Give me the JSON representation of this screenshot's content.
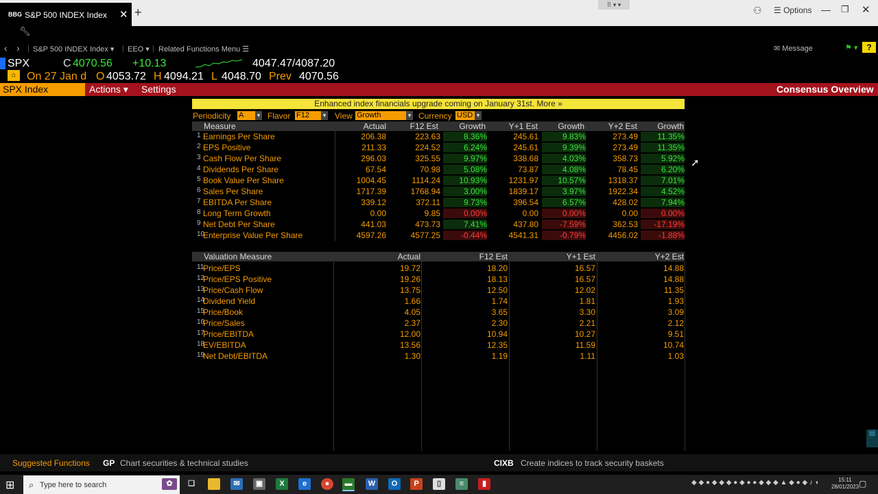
{
  "browser": {
    "tab_logo": "BBG",
    "tab_title": "S&P 500 INDEX Index",
    "tab_close": "✕",
    "new_tab": "+",
    "options_label": "Options"
  },
  "nav": {
    "back": "‹",
    "forward": "›",
    "security": "S&P 500 INDEX Index ▾",
    "eeo": "EEO ▾",
    "related": "Related Functions Menu ☰",
    "message": "Message",
    "help": "?"
  },
  "quote": {
    "ticker": "SPX",
    "close_label": "C",
    "close": "4070.56",
    "change": "+10.13",
    "range": "4047.47/4087.20",
    "date_text": "On 27 Jan d",
    "open_label": "O",
    "open": "4053.72",
    "high_label": "H",
    "high": "4094.21",
    "low_label": "L",
    "low": "4048.70",
    "prev_label": "Prev",
    "prev": "4070.56"
  },
  "menubar": {
    "security_box": "SPX Index",
    "actions": "Actions ▾",
    "settings": "Settings",
    "function_title": "Consensus Overview"
  },
  "banner": "Enhanced index financials upgrade coming on January 31st. More »",
  "filters": {
    "periodicity_label": "Periodicity",
    "periodicity_value": "A",
    "flavor_label": "Flavor",
    "flavor_value": "F12",
    "view_label": "View",
    "view_value": "Growth",
    "currency_label": "Currency",
    "currency_value": "USD"
  },
  "measures_table": {
    "headers": [
      "Measure",
      "Actual",
      "F12 Est",
      "Growth",
      "Y+1 Est",
      "Growth",
      "Y+2 Est",
      "Growth"
    ],
    "rows": [
      {
        "n": "1",
        "label": "Earnings Per Share",
        "actual": "206.38",
        "f12": "223.63",
        "g1": "8.36%",
        "y1": "245.61",
        "g2": "9.83%",
        "y2": "273.49",
        "g3": "11.35%"
      },
      {
        "n": "2",
        "label": "EPS Positive",
        "actual": "211.33",
        "f12": "224.52",
        "g1": "6.24%",
        "y1": "245.61",
        "g2": "9.39%",
        "y2": "273.49",
        "g3": "11.35%"
      },
      {
        "n": "3",
        "label": "Cash Flow Per Share",
        "actual": "296.03",
        "f12": "325.55",
        "g1": "9.97%",
        "y1": "338.68",
        "g2": "4.03%",
        "y2": "358.73",
        "g3": "5.92%"
      },
      {
        "n": "4",
        "label": "Dividends Per Share",
        "actual": "67.54",
        "f12": "70.98",
        "g1": "5.08%",
        "y1": "73.87",
        "g2": "4.08%",
        "y2": "78.45",
        "g3": "6.20%"
      },
      {
        "n": "5",
        "label": "Book Value Per Share",
        "actual": "1004.45",
        "f12": "1114.24",
        "g1": "10.93%",
        "y1": "1231.97",
        "g2": "10.57%",
        "y2": "1318.37",
        "g3": "7.01%"
      },
      {
        "n": "6",
        "label": "Sales Per Share",
        "actual": "1717.39",
        "f12": "1768.94",
        "g1": "3.00%",
        "y1": "1839.17",
        "g2": "3.97%",
        "y2": "1922.34",
        "g3": "4.52%"
      },
      {
        "n": "7",
        "label": "EBITDA Per Share",
        "actual": "339.12",
        "f12": "372.11",
        "g1": "9.73%",
        "y1": "396.54",
        "g2": "6.57%",
        "y2": "428.02",
        "g3": "7.94%"
      },
      {
        "n": "8",
        "label": "Long Term Growth",
        "actual": "0.00",
        "f12": "9.85",
        "g1": "0.00%",
        "y1": "0.00",
        "g2": "0.00%",
        "y2": "0.00",
        "g3": "0.00%"
      },
      {
        "n": "9",
        "label": "Net Debt Per Share",
        "actual": "441.03",
        "f12": "473.73",
        "g1": "7.41%",
        "y1": "437.80",
        "g2": "-7.59%",
        "y2": "362.53",
        "g3": "-17.19%"
      },
      {
        "n": "10",
        "label": "Enterprise Value Per Share",
        "actual": "4597.26",
        "f12": "4577.25",
        "g1": "-0.44%",
        "y1": "4541.31",
        "g2": "-0.79%",
        "y2": "4456.02",
        "g3": "-1.88%"
      }
    ]
  },
  "valuation_table": {
    "headers": [
      "Valuation Measure",
      "Actual",
      "F12 Est",
      "Y+1 Est",
      "Y+2 Est"
    ],
    "rows": [
      {
        "n": "11",
        "label": "Price/EPS",
        "actual": "19.72",
        "f12": "18.20",
        "y1": "16.57",
        "y2": "14.88"
      },
      {
        "n": "12",
        "label": "Price/EPS Positive",
        "actual": "19.26",
        "f12": "18.13",
        "y1": "16.57",
        "y2": "14.88"
      },
      {
        "n": "13",
        "label": "Price/Cash Flow",
        "actual": "13.75",
        "f12": "12.50",
        "y1": "12.02",
        "y2": "11.35"
      },
      {
        "n": "14",
        "label": "Dividend Yield",
        "actual": "1.66",
        "f12": "1.74",
        "y1": "1.81",
        "y2": "1.93"
      },
      {
        "n": "15",
        "label": "Price/Book",
        "actual": "4.05",
        "f12": "3.65",
        "y1": "3.30",
        "y2": "3.09"
      },
      {
        "n": "16",
        "label": "Price/Sales",
        "actual": "2.37",
        "f12": "2.30",
        "y1": "2.21",
        "y2": "2.12"
      },
      {
        "n": "17",
        "label": "Price/EBITDA",
        "actual": "12.00",
        "f12": "10.94",
        "y1": "10.27",
        "y2": "9.51"
      },
      {
        "n": "18",
        "label": "EV/EBITDA",
        "actual": "13.56",
        "f12": "12.35",
        "y1": "11.59",
        "y2": "10.74"
      },
      {
        "n": "19",
        "label": "Net Debt/EBITDA",
        "actual": "1.30",
        "f12": "1.19",
        "y1": "1.11",
        "y2": "1.03"
      }
    ]
  },
  "suggested": {
    "label": "Suggested Functions",
    "f1_code": "GP",
    "f1_desc": "Chart securities & technical studies",
    "f2_code": "CIXB",
    "f2_desc": "Create indices to track security baskets"
  },
  "taskbar": {
    "search_placeholder": "Type here to search",
    "clock_time": "15:11",
    "clock_date": "28/01/2023"
  },
  "colors": {
    "bloomberg_orange": "#f59c00",
    "positive": "#39e639",
    "negative": "#ff3b3b",
    "menu_red": "#a4131d",
    "banner_yellow": "#f5e43a"
  }
}
